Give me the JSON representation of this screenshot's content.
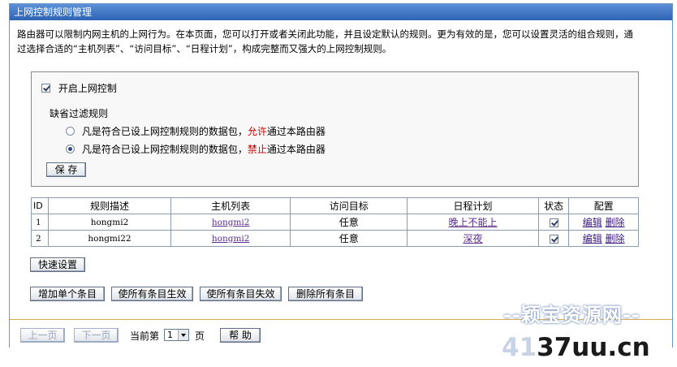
{
  "title": "上网控制规则管理",
  "description": "路由器可以限制内网主机的上网行为。在本页面，您可以打开或者关闭此功能，并且设定默认的规则。更为有效的是，您可以设置灵活的组合规则，通过选择合适的“主机列表”、“访问目标”、“日程计划”，构成完整而又强大的上网控制规则。",
  "settings": {
    "enable_label": "开启上网控制",
    "enable_checked": true,
    "default_rule_label": "缺省过滤规则",
    "option_allow": {
      "prefix": "凡是符合已设上网控制规则的数据包，",
      "keyword": "允许",
      "suffix": "通过本路由器"
    },
    "option_deny": {
      "prefix": "凡是符合已设上网控制规则的数据包，",
      "keyword": "禁止",
      "suffix": "通过本路由器"
    },
    "selected": "deny",
    "save_label": "保 存"
  },
  "table": {
    "headers": [
      "ID",
      "规则描述",
      "主机列表",
      "访问目标",
      "日程计划",
      "状态",
      "配置"
    ],
    "rows": [
      {
        "id": "1",
        "desc": "hongmi2",
        "hosts": "hongmi2",
        "target": "任意",
        "schedule": "晚上不能上",
        "enabled": true,
        "edit": "编辑",
        "delete": "删除"
      },
      {
        "id": "2",
        "desc": "hongmi22",
        "hosts": "hongmi2",
        "target": "任意",
        "schedule": "深夜",
        "enabled": true,
        "edit": "编辑",
        "delete": "删除"
      }
    ]
  },
  "buttons": {
    "quick_setup": "快速设置",
    "add_one": "增加单个条目",
    "enable_all": "使所有条目生效",
    "disable_all": "使所有条目失效",
    "delete_all": "删除所有条目"
  },
  "pagination": {
    "prev": "上一页",
    "next": "下一页",
    "current_prefix": "当前第",
    "page_value": "1",
    "page_suffix": "页",
    "help": "帮 助"
  },
  "watermark": {
    "line1": "--颖宝资源网--",
    "line2_a": "41",
    "line2_b": "37uu.cn"
  },
  "colors": {
    "title_bar": "#2e63b5",
    "accent_red": "#cc0000",
    "separator": "#e0a94a",
    "link": "#5b2d8f"
  }
}
